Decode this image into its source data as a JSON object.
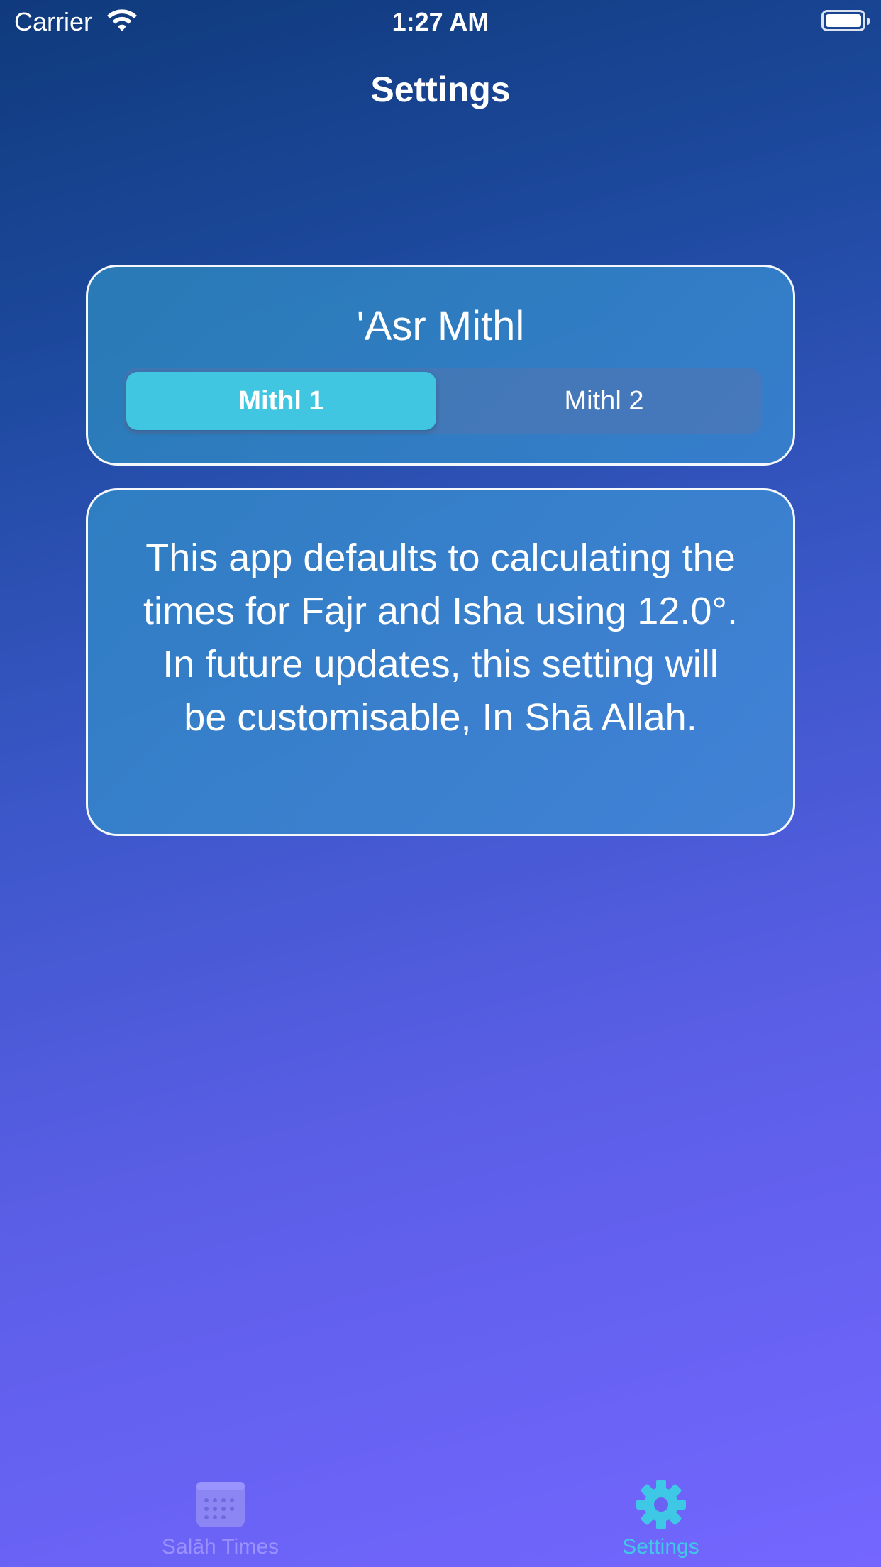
{
  "status_bar": {
    "carrier": "Carrier",
    "time": "1:27 AM",
    "wifi_icon": "wifi-icon",
    "battery_icon": "battery-icon"
  },
  "nav": {
    "title": "Settings"
  },
  "asr_card": {
    "title": "'Asr Mithl",
    "options": [
      "Mithl 1",
      "Mithl 2"
    ],
    "selected": "Mithl 1",
    "selected_color": "#40c6e0"
  },
  "info_card": {
    "text": "This app defaults to calculating the times for Fajr and Isha using 12.0°. In future updates, this setting will be customisable, In Shā Allah."
  },
  "tab_bar": {
    "tabs": [
      {
        "label": "Salāh Times",
        "icon": "calendar-icon",
        "active": false
      },
      {
        "label": "Settings",
        "icon": "gear-icon",
        "active": true
      }
    ],
    "active_color": "#3ec8e6",
    "inactive_color": "#a096ff"
  }
}
